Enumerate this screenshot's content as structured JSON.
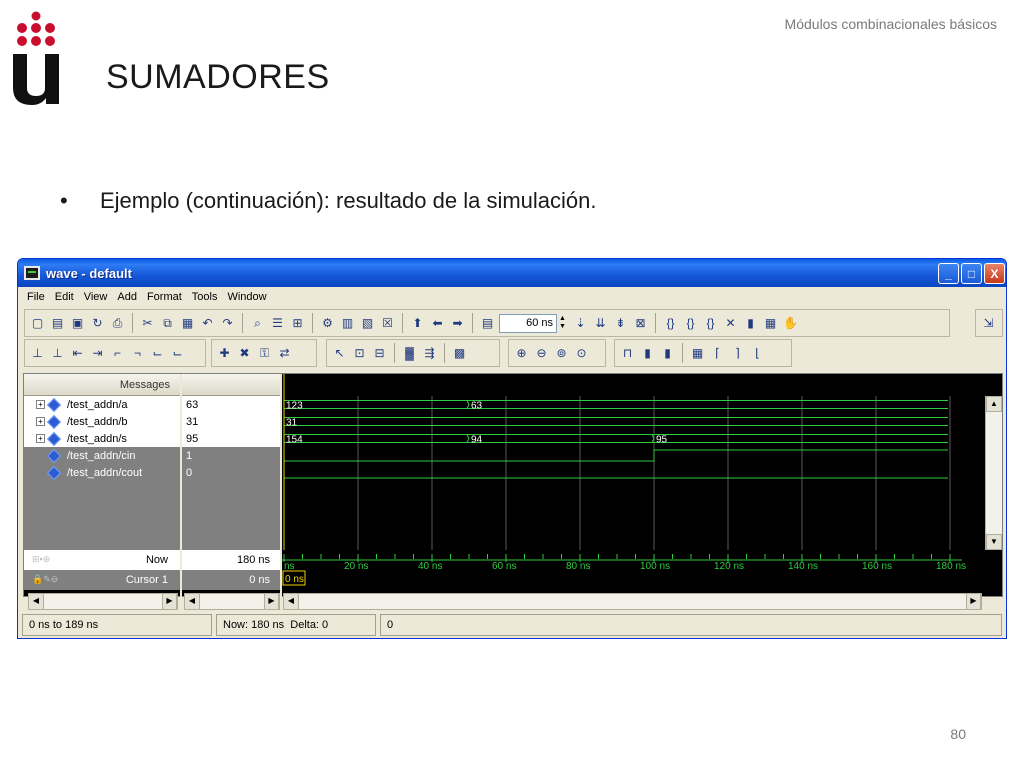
{
  "slide": {
    "header_right": "Módulos combinacionales básicos",
    "title": "SUMADORES",
    "bullet": "Ejemplo (continuación): resultado de la simulación.",
    "page_number": "80",
    "logo_color": "#c8102e"
  },
  "window": {
    "title": "wave - default",
    "menu": [
      "File",
      "Edit",
      "View",
      "Add",
      "Format",
      "Tools",
      "Window"
    ],
    "zoom_value": "60 ns",
    "buttons": {
      "minimize": "_",
      "maximize": "□",
      "close": "X"
    }
  },
  "wave": {
    "messages_header": "Messages",
    "signals": [
      {
        "name": "/test_addn/a",
        "value": "63",
        "expandable": true
      },
      {
        "name": "/test_addn/b",
        "value": "31",
        "expandable": true
      },
      {
        "name": "/test_addn/s",
        "value": "95",
        "expandable": true
      },
      {
        "name": "/test_addn/cin",
        "value": "1",
        "expandable": false
      },
      {
        "name": "/test_addn/cout",
        "value": "0",
        "expandable": false
      }
    ],
    "bus_labels": {
      "a": [
        "123",
        "63"
      ],
      "b": [
        "31"
      ],
      "s": [
        "154",
        "94",
        "95"
      ]
    },
    "transitions_ns": {
      "a": [
        0,
        50
      ],
      "b": [
        0
      ],
      "s": [
        0,
        50,
        100
      ],
      "cin": [
        0,
        100
      ]
    },
    "now_label": "Now",
    "now_value": "180 ns",
    "cursor_label": "Cursor 1",
    "cursor_value": "0 ns",
    "cursor_marker": "0 ns",
    "time_ticks": [
      "ns",
      "20 ns",
      "40 ns",
      "60 ns",
      "80 ns",
      "100 ns",
      "120 ns",
      "140 ns",
      "160 ns",
      "180 ns"
    ],
    "time_range_ns": [
      0,
      189
    ],
    "wave_color": "#2ecc40"
  },
  "status": {
    "range": "0 ns to 189 ns",
    "now_delta": "Now: 180 ns  Delta: 0",
    "value": "0"
  }
}
